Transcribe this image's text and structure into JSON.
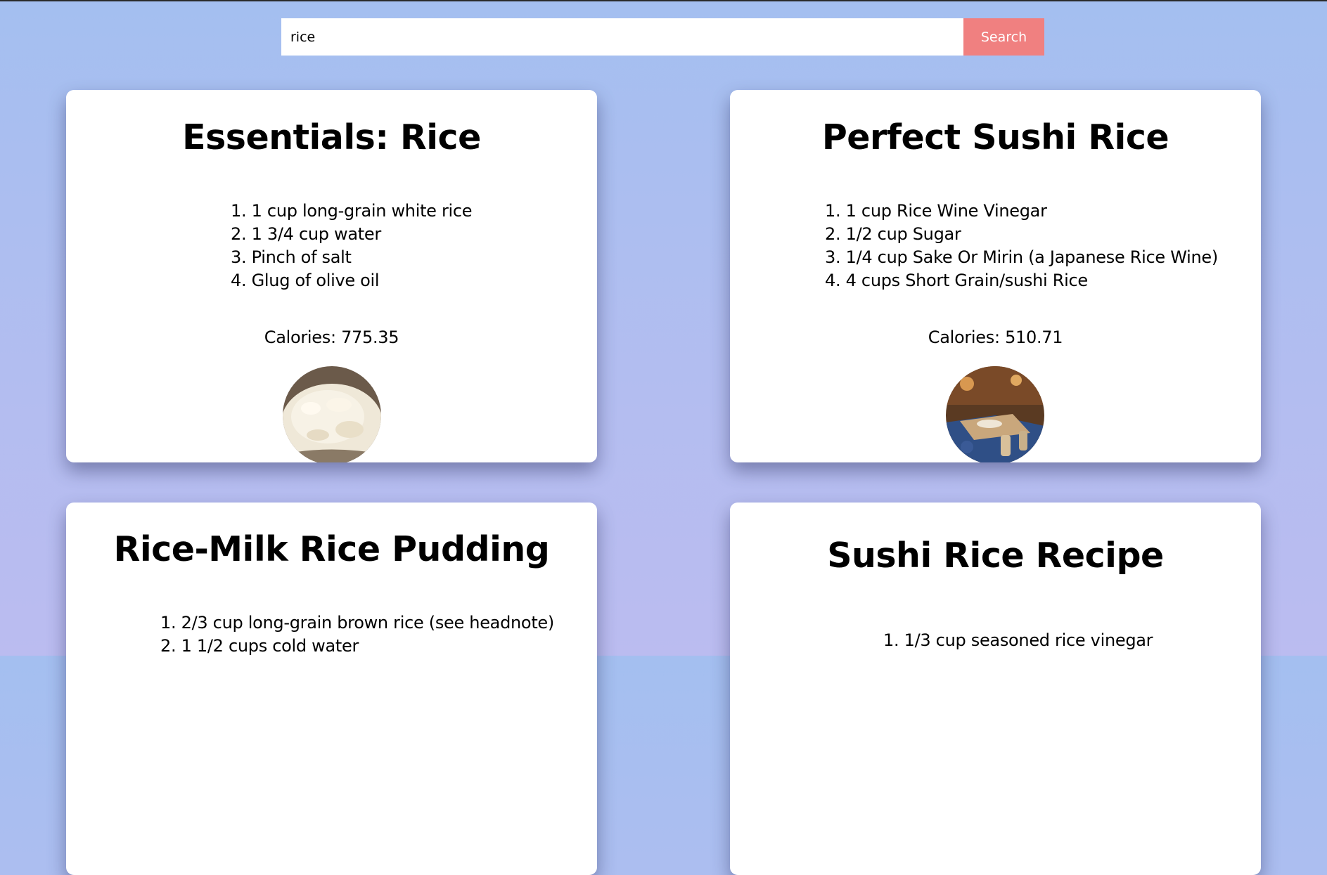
{
  "search": {
    "value": "rice",
    "button_label": "Search"
  },
  "recipes": [
    {
      "title": "Essentials: Rice",
      "ingredients": [
        "1. 1 cup long-grain white rice",
        "2. 1 3/4 cup water",
        "3. Pinch of salt",
        "4. Glug of olive oil"
      ],
      "calories": "Calories: 775.35",
      "image_icon": "bowl-of-white-rice"
    },
    {
      "title": "Perfect Sushi Rice",
      "ingredients": [
        "1. 1 cup Rice Wine Vinegar",
        "2. 1/2 cup Sugar",
        "3. 1/4 cup Sake Or Mirin (a Japanese Rice Wine)",
        "4. 4 cups Short Grain/sushi Rice"
      ],
      "calories": "Calories: 510.71",
      "image_icon": "sushi-kitchen-scene"
    },
    {
      "title": "Rice-Milk Rice Pudding",
      "ingredients": [
        "1. 2/3 cup long-grain brown rice (see headnote)",
        "2. 1 1/2 cups cold water"
      ]
    },
    {
      "title": "Sushi Rice Recipe",
      "ingredients": [
        "1. 1/3 cup seasoned rice vinegar"
      ]
    }
  ],
  "colors": {
    "background_top": "#a4bff0",
    "background_bottom": "#bbbcf0",
    "search_button": "#f08080",
    "card": "#ffffff"
  }
}
